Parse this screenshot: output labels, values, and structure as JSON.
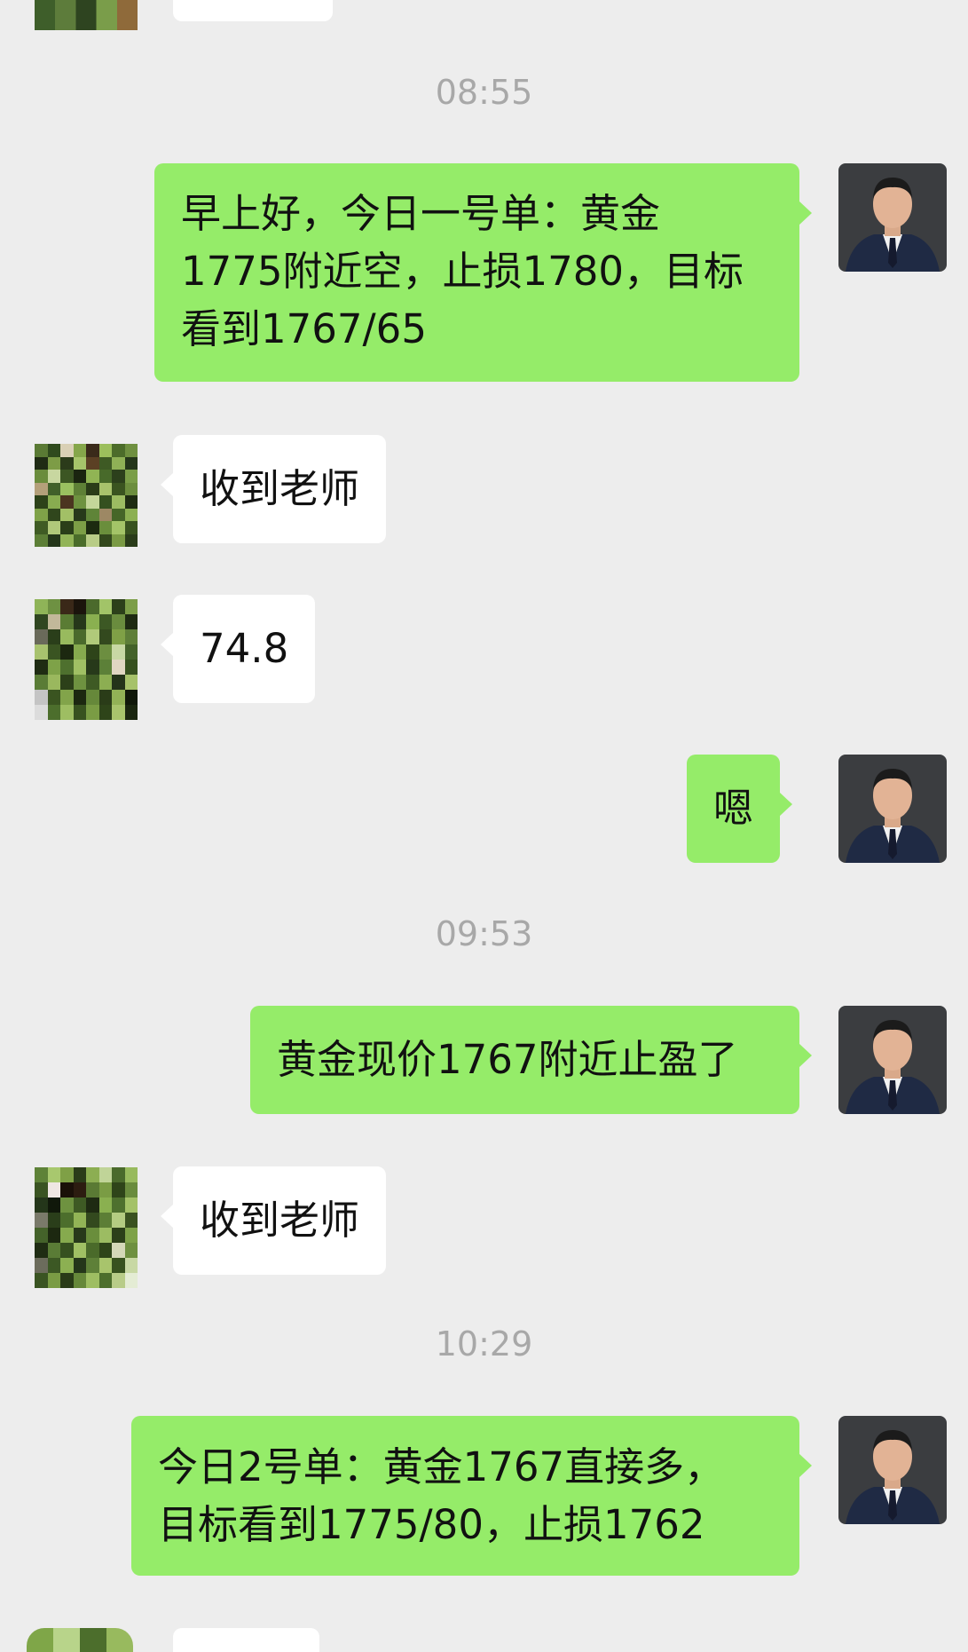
{
  "colors": {
    "background": "#ededed",
    "my_bubble": "#95ec69",
    "their_bubble": "#ffffff",
    "timestamp": "#a8a8a8"
  },
  "timestamps": {
    "t1": "08:55",
    "t2": "09:53",
    "t3": "10:29"
  },
  "messages": {
    "m1": [
      "早上好，今日一号单：黄金",
      "1775附近空，止损1780，目标",
      "看到1767/65"
    ],
    "m2": "收到老师",
    "m3": "74.8",
    "m4": "嗯",
    "m5": "黄金现价1767附近止盈了",
    "m6": "收到老师",
    "m7": [
      "今日2号单：黄金1767直接多，",
      "目标看到1775/80，止损1762"
    ]
  },
  "avatars": {
    "me": "teacher-portrait-avatar-icon",
    "them": "pixelated-green-avatar-icon"
  }
}
